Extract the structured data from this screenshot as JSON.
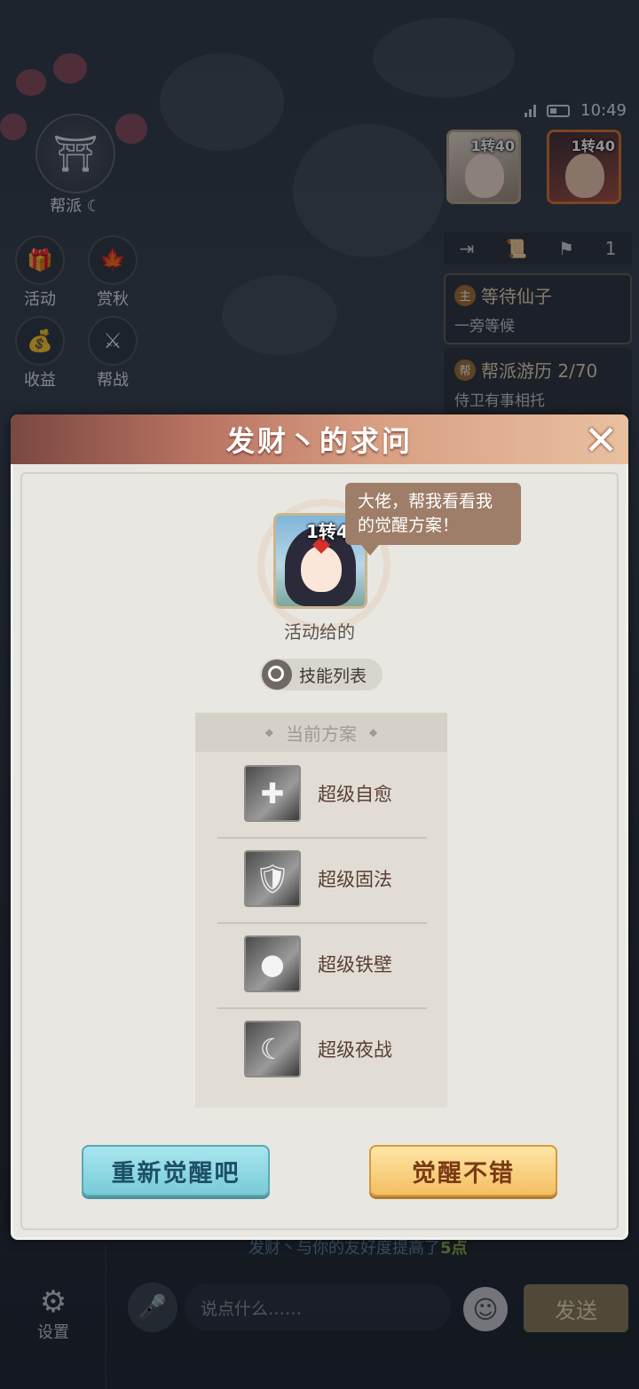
{
  "status_bar": {
    "time": "10:49"
  },
  "left_menu": {
    "sect": "帮派",
    "items": [
      {
        "label": "活动"
      },
      {
        "label": "赏秋"
      },
      {
        "label": "收益"
      },
      {
        "label": "帮战"
      }
    ]
  },
  "portraits": [
    {
      "level": "1转40"
    },
    {
      "level": "1转40"
    }
  ],
  "task_bar": {
    "count": "1"
  },
  "tasks": [
    {
      "badge": "主",
      "title": "等待仙子",
      "desc": "一旁等候"
    },
    {
      "badge": "帮",
      "title": "帮派游历 2/70",
      "desc": "侍卫有事相托"
    }
  ],
  "modal": {
    "title": "发财丶的求问",
    "speech": "大佬，帮我看看我的觉醒方案！",
    "pet_level": "1转40",
    "pet_name": "活动给的",
    "skill_list_label": "技能列表",
    "plan_title": "当前方案",
    "skills": [
      {
        "name": "超级自愈",
        "icon": "heal-cross-icon"
      },
      {
        "name": "超级固法",
        "icon": "fire-shield-icon"
      },
      {
        "name": "超级铁壁",
        "icon": "iron-wall-icon"
      },
      {
        "name": "超级夜战",
        "icon": "moon-icon"
      }
    ],
    "redo_label": "重新觉醒吧",
    "good_label": "觉醒不错"
  },
  "chat": {
    "system_msg_prefix": "发财丶与你的友好度提高了",
    "system_msg_value": "5点",
    "settings_label": "设置",
    "input_placeholder": "说点什么……",
    "send_label": "发送"
  }
}
